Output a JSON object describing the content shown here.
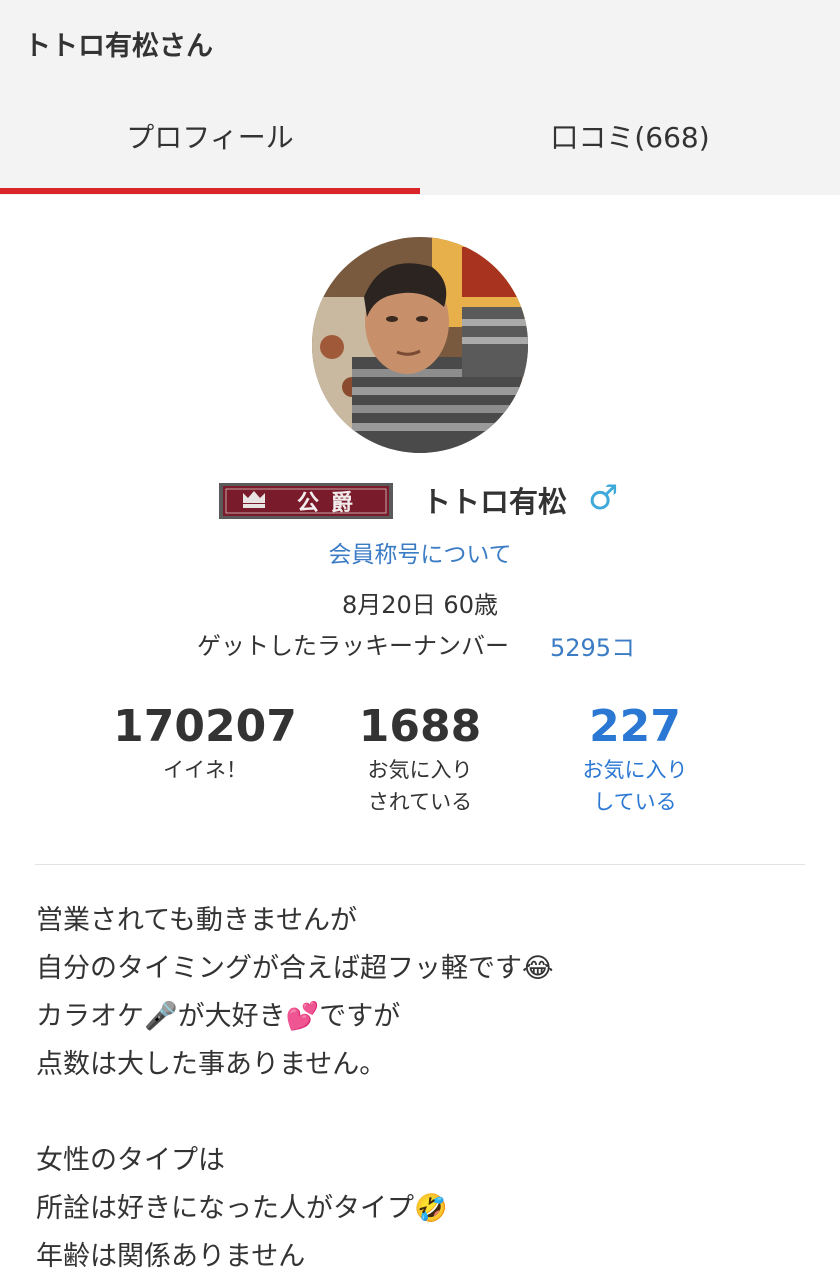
{
  "header": {
    "title": "トトロ有松さん",
    "tabs": [
      {
        "label": "プロフィール",
        "active": true
      },
      {
        "label": "口コミ(668)",
        "active": false
      }
    ],
    "indicator_color": "#d9242a"
  },
  "profile": {
    "rank_badge": "公爵",
    "name": "トトロ有松",
    "gender_symbol": "♂",
    "rank_link": "会員称号について",
    "birthday_age": "8月20日 60歳",
    "lucky_label": "ゲットしたラッキーナンバー",
    "lucky_value": "5295コ"
  },
  "stats": [
    {
      "value": "170207",
      "label1": "イイネ！",
      "label2": ""
    },
    {
      "value": "1688",
      "label1": "お気に入り",
      "label2": "されている"
    },
    {
      "value": "227",
      "label1": "お気に入り",
      "label2": "している"
    }
  ],
  "bio": {
    "lines": [
      "営業されても動きませんが",
      "自分のタイミングが合えば超フッ軽です😂",
      "カラオケ🎤が大好き💕ですが",
      "点数は大した事ありません。",
      "",
      "女性のタイプは",
      "所詮は好きになった人がタイプ🤣",
      "年齢は関係ありません"
    ]
  },
  "colors": {
    "link_blue": "#3b7cc4",
    "stat_blue": "#2b78d4",
    "gender_blue": "#3fa9d9",
    "badge_maroon": "#7a1b2b"
  }
}
